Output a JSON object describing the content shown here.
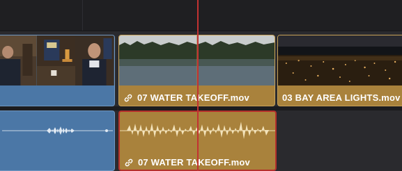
{
  "timeline": {
    "video_clips": [
      {
        "name": "interview-clip",
        "label": ""
      },
      {
        "name": "water-takeoff-video",
        "label": "07 WATER TAKEOFF.mov"
      },
      {
        "name": "bay-area-lights-video",
        "label": "03 BAY AREA LIGHTS.mov"
      }
    ],
    "audio_clips": [
      {
        "name": "interview-audio",
        "label": ""
      },
      {
        "name": "water-takeoff-audio",
        "label": "07 WATER TAKEOFF.mov"
      }
    ]
  },
  "colors": {
    "video_clip_blue": "#4b77a6",
    "clip_gold": "#a9823c",
    "selection_red": "#b5302c",
    "playhead": "#c23232"
  },
  "icons": [
    "link-icon"
  ]
}
